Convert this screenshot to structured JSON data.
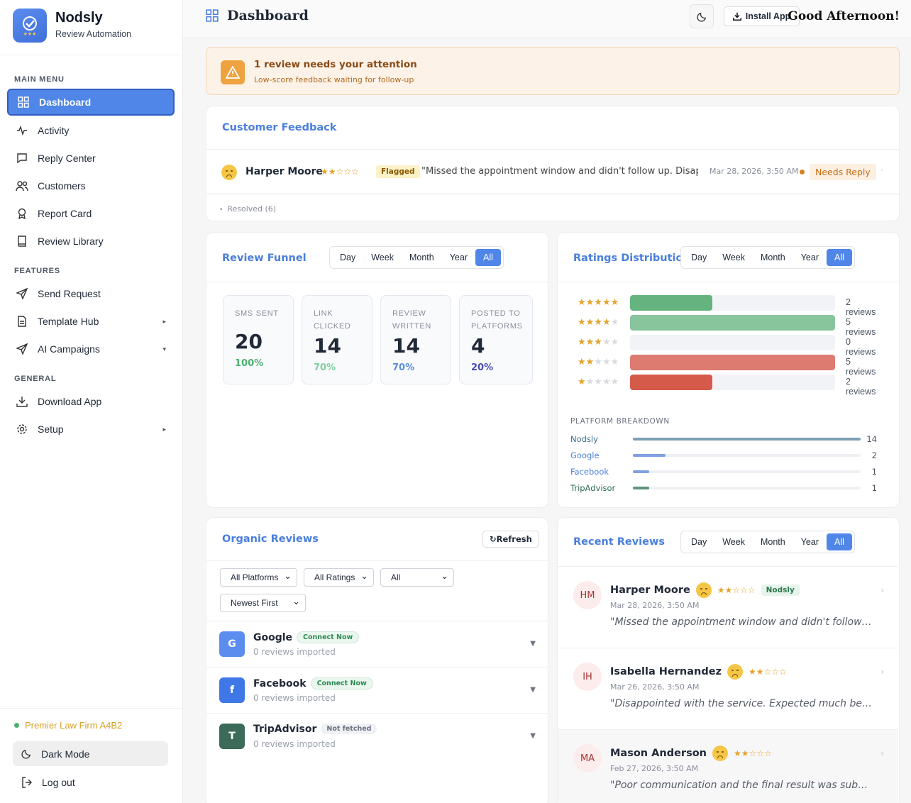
{
  "brand": {
    "name": "Nodsly",
    "subtitle": "Review Automation"
  },
  "sidebar": {
    "main_menu": "MAIN MENU",
    "features": "FEATURES",
    "general": "GENERAL",
    "items": [
      {
        "label": "Dashboard",
        "icon": "grid-icon"
      },
      {
        "label": "Activity",
        "icon": "activity-icon"
      },
      {
        "label": "Reply Center",
        "icon": "chat-icon"
      },
      {
        "label": "Customers",
        "icon": "users-icon"
      },
      {
        "label": "Report Card",
        "icon": "award-icon"
      },
      {
        "label": "Review Library",
        "icon": "book-icon"
      },
      {
        "label": "Send Request",
        "icon": "send-icon"
      },
      {
        "label": "Template Hub",
        "icon": "file-icon"
      },
      {
        "label": "AI Campaigns",
        "icon": "send-icon"
      },
      {
        "label": "Download App",
        "icon": "download-icon"
      },
      {
        "label": "Setup",
        "icon": "gear-icon"
      }
    ],
    "firm": "Premier Law Firm A4B2",
    "dark_mode": "Dark Mode",
    "logout": "Log out"
  },
  "topbar": {
    "title": "Dashboard",
    "install": "Install App",
    "greeting": "Good Afternoon!"
  },
  "alert": {
    "title": "1 review needs your attention",
    "subtitle": "Low-score feedback waiting for follow-up"
  },
  "feedback": {
    "title": "Customer Feedback",
    "name": "Harper Moore",
    "stars": "★★☆☆☆",
    "flag": "Flagged",
    "quote": "\"Missed the appointment window and didn't follow up. Disapp...",
    "date": "Mar 28, 2026, 3:50 AM",
    "status": "Needs Reply",
    "resolved": "Resolved (6)"
  },
  "periods": [
    "Day",
    "Week",
    "Month",
    "Year",
    "All"
  ],
  "funnel": {
    "title": "Review Funnel",
    "stats": [
      {
        "label": "SMS SENT",
        "value": "20",
        "pct": "100%",
        "color": "#4caf70"
      },
      {
        "label": "LINK CLICKED",
        "value": "14",
        "pct": "70%",
        "color": "#7fcfa0"
      },
      {
        "label": "REVIEW WRITTEN",
        "value": "14",
        "pct": "70%",
        "color": "#5b8de0"
      },
      {
        "label": "POSTED TO PLATFORMS",
        "value": "4",
        "pct": "20%",
        "color": "#4a4ab0"
      }
    ]
  },
  "ratings": {
    "title": "Ratings Distribution",
    "rows": [
      {
        "stars": 5,
        "fraction": 0.4,
        "label": "2 reviews",
        "color": "#65b37f"
      },
      {
        "stars": 4,
        "fraction": 1.0,
        "label": "5 reviews",
        "color": "#88c49c"
      },
      {
        "stars": 3,
        "fraction": 0,
        "label": "0 reviews",
        "color": "#d9d9d9"
      },
      {
        "stars": 2,
        "fraction": 1.0,
        "label": "5 reviews",
        "color": "#dd7b70"
      },
      {
        "stars": 1,
        "fraction": 0.4,
        "label": "2 reviews",
        "color": "#d55a4a"
      }
    ],
    "platform_title": "PLATFORM BREAKDOWN",
    "platforms": [
      {
        "name": "Nodsly",
        "value": 14,
        "text": "14",
        "color": "#7d9eb4",
        "name_color": "#3b6f8f"
      },
      {
        "name": "Google",
        "value": 2,
        "text": "2",
        "color": "#7fa0e3",
        "name_color": "#4a7fdc"
      },
      {
        "name": "Facebook",
        "value": 1,
        "text": "1",
        "color": "#7fa0e3",
        "name_color": "#4a7fdc"
      },
      {
        "name": "TripAdvisor",
        "value": 1,
        "text": "1",
        "color": "#5f9478",
        "name_color": "#2e6a52"
      }
    ]
  },
  "organic": {
    "title": "Organic Reviews",
    "refresh": "↻Refresh",
    "filters": [
      "All Platforms",
      "All Ratings",
      "All",
      "Newest First"
    ],
    "platforms": [
      {
        "letter": "G",
        "name": "Google",
        "badge": "Connect Now",
        "sub": "0 reviews imported",
        "color": "#5b8def"
      },
      {
        "letter": "f",
        "name": "Facebook",
        "badge": "Connect Now",
        "sub": "0 reviews imported",
        "color": "#3f78e6"
      },
      {
        "letter": "T",
        "name": "TripAdvisor",
        "badge": "Not fetched",
        "sub": "0 reviews imported",
        "color": "#3c6b5a"
      }
    ]
  },
  "recent": {
    "title": "Recent Reviews",
    "items": [
      {
        "initials": "HM",
        "name": "Harper Moore",
        "stars": "★★☆☆☆",
        "tag": "Nodsly",
        "date": "Mar 28, 2026, 3:50 AM",
        "quote": "\"Missed the appointment window and didn't follow up. Disappointed.\""
      },
      {
        "initials": "IH",
        "name": "Isabella Hernandez",
        "stars": "★★☆☆☆",
        "tag": "",
        "date": "Mar 26, 2026, 3:50 AM",
        "quote": "\"Disappointed with the service. Expected much better.\""
      },
      {
        "initials": "MA",
        "name": "Mason Anderson",
        "stars": "★★☆☆☆",
        "tag": "",
        "date": "Feb 27, 2026, 3:50 AM",
        "quote": "\"Poor communication and the final result was subpar.\""
      }
    ]
  }
}
